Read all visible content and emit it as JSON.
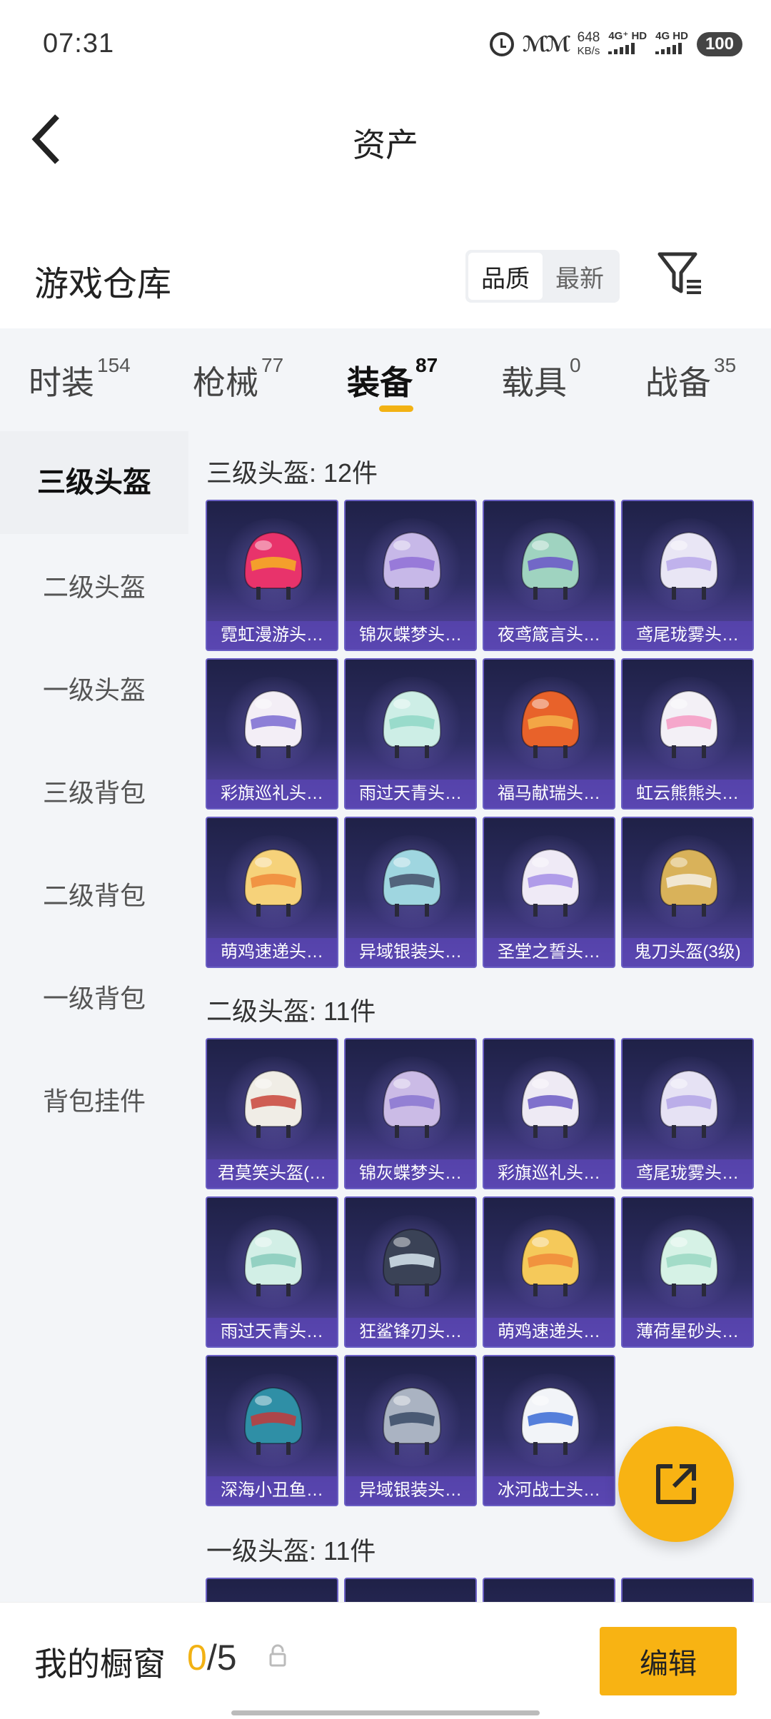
{
  "status_bar": {
    "time": "07:31",
    "speed_value": "648",
    "speed_unit": "KB/s",
    "network_1": "4G⁺ HD",
    "network_2": "4G HD",
    "battery": "100"
  },
  "header": {
    "title": "资产"
  },
  "section": {
    "title": "游戏仓库",
    "sort_options": [
      "品质",
      "最新"
    ],
    "sort_selected": "品质"
  },
  "tabs": [
    {
      "label": "时装",
      "count": "154",
      "active": false
    },
    {
      "label": "枪械",
      "count": "77",
      "active": false
    },
    {
      "label": "装备",
      "count": "87",
      "active": true
    },
    {
      "label": "载具",
      "count": "0",
      "active": false
    },
    {
      "label": "战备",
      "count": "35",
      "active": false
    }
  ],
  "sidebar": {
    "items": [
      "三级头盔",
      "二级头盔",
      "一级头盔",
      "三级背包",
      "二级背包",
      "一级背包",
      "背包挂件"
    ],
    "selected": "三级头盔"
  },
  "groups": [
    {
      "title": "三级头盔: 12件",
      "items": [
        {
          "name": "霓虹漫游头…",
          "color": "#e8336b",
          "accent": "#f6b321"
        },
        {
          "name": "锦灰蝶梦头…",
          "color": "#c7b8e8",
          "accent": "#8f6fd6"
        },
        {
          "name": "夜鸢箴言头…",
          "color": "#9fd3c0",
          "accent": "#6a55c8"
        },
        {
          "name": "鸢尾珑雾头…",
          "color": "#e9e6f5",
          "accent": "#b8a8ea"
        },
        {
          "name": "彩旗巡礼头…",
          "color": "#f3eef6",
          "accent": "#7a6bd1"
        },
        {
          "name": "雨过天青头…",
          "color": "#cdeee6",
          "accent": "#8fd7c6"
        },
        {
          "name": "福马献瑞头…",
          "color": "#e8622a",
          "accent": "#f4b34a"
        },
        {
          "name": "虹云熊熊头…",
          "color": "#f3f0f6",
          "accent": "#f49ac3"
        },
        {
          "name": "萌鸡速递头…",
          "color": "#f6d27a",
          "accent": "#f08a3a"
        },
        {
          "name": "异域银装头…",
          "color": "#9fd6e0",
          "accent": "#44506a"
        },
        {
          "name": "圣堂之誓头…",
          "color": "#efeaf6",
          "accent": "#a58ee6"
        },
        {
          "name": "鬼刀头盔(3级)",
          "color": "#d9b25a",
          "accent": "#f4f0e6"
        }
      ]
    },
    {
      "title": "二级头盔: 11件",
      "items": [
        {
          "name": "君莫笑头盔(…",
          "color": "#f0ede6",
          "accent": "#c9443a"
        },
        {
          "name": "锦灰蝶梦头…",
          "color": "#cbbbe6",
          "accent": "#8a76d0"
        },
        {
          "name": "彩旗巡礼头…",
          "color": "#eeeaf4",
          "accent": "#6c5cc4"
        },
        {
          "name": "鸢尾珑雾头…",
          "color": "#e6e2f4",
          "accent": "#b3a4e6"
        },
        {
          "name": "雨过天青头…",
          "color": "#d2efe6",
          "accent": "#88cbbb"
        },
        {
          "name": "狂鲨锋刃头…",
          "color": "#3a4256",
          "accent": "#d8e6f0"
        },
        {
          "name": "萌鸡速递头…",
          "color": "#f5c95a",
          "accent": "#f08a3a"
        },
        {
          "name": "薄荷星砂头…",
          "color": "#d6f2e6",
          "accent": "#9ad8c2"
        },
        {
          "name": "深海小丑鱼…",
          "color": "#2f8fa6",
          "accent": "#c23a3a"
        },
        {
          "name": "异域银装头…",
          "color": "#aab3c2",
          "accent": "#3a4a66"
        },
        {
          "name": "冰河战士头…",
          "color": "#f2f4f8",
          "accent": "#3a6ad6"
        }
      ]
    },
    {
      "title": "一级头盔: 11件",
      "items": []
    }
  ],
  "bottom_bar": {
    "showcase_label": "我的橱窗",
    "showcase_current": "0",
    "showcase_sep": "/",
    "showcase_total": "5",
    "edit_label": "编辑"
  },
  "icons": {
    "back": "chevron-left-icon",
    "filter": "filter-icon",
    "share": "share-external-icon",
    "lock": "lock-icon"
  }
}
